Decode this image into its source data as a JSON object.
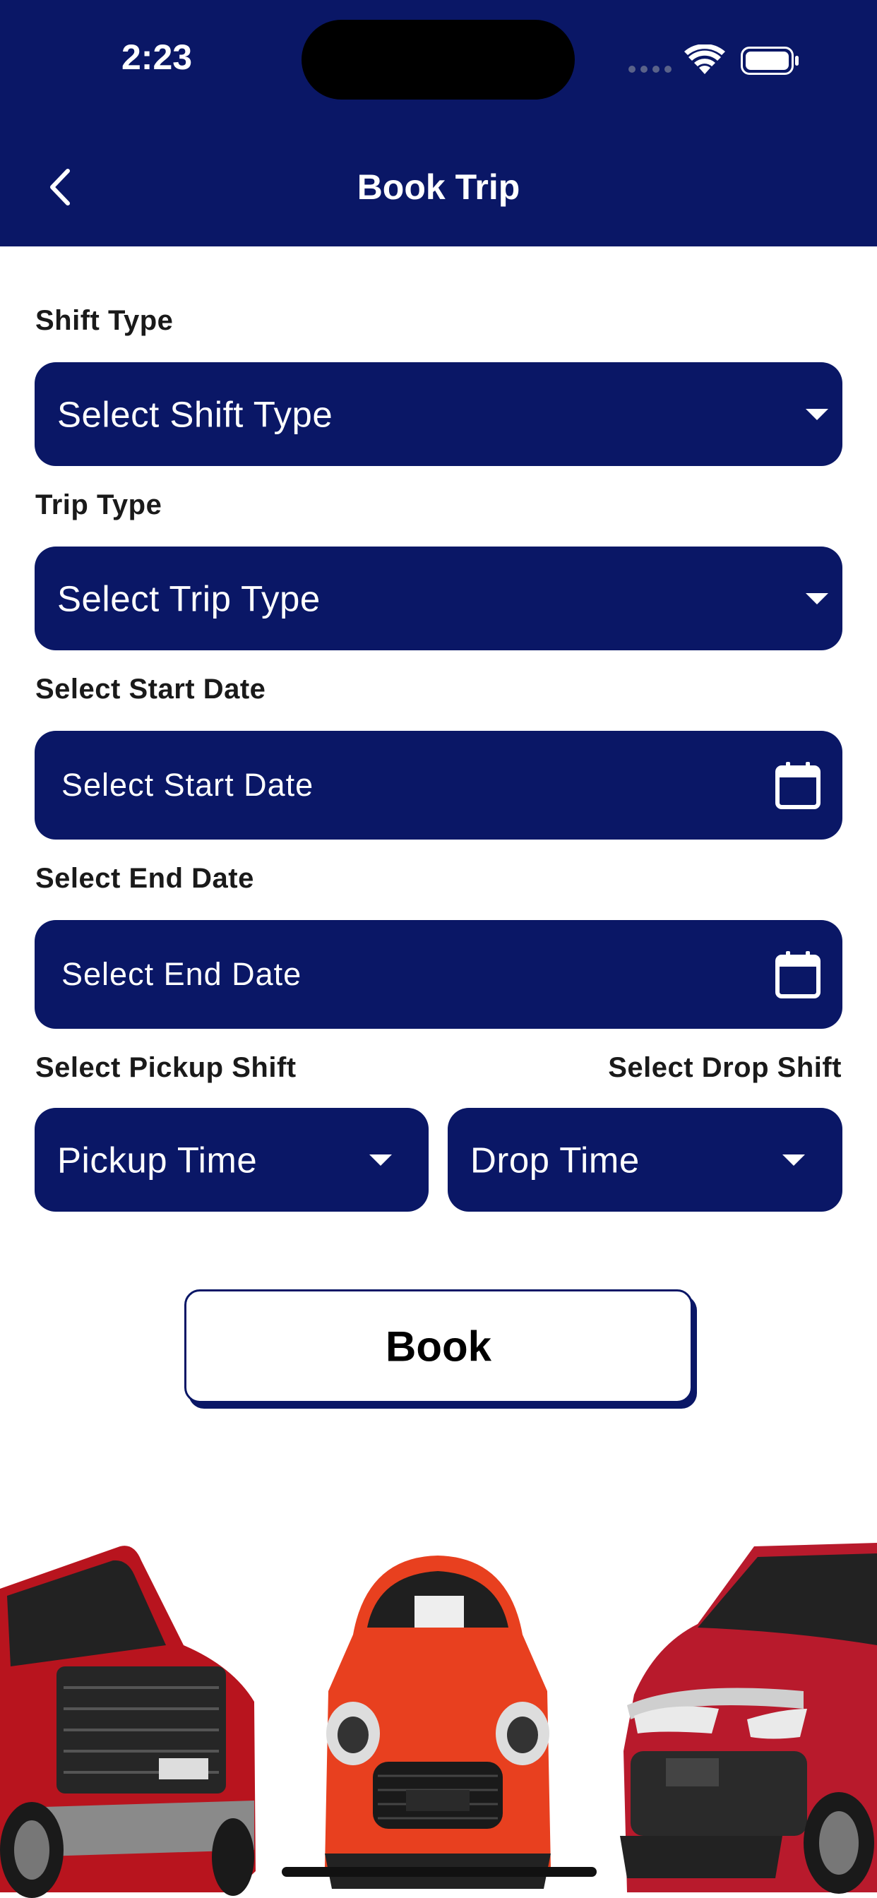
{
  "status_bar": {
    "time": "2:23"
  },
  "header": {
    "title": "Book Trip"
  },
  "form": {
    "shift_type": {
      "label": "Shift Type",
      "value": "Select Shift Type"
    },
    "trip_type": {
      "label": "Trip Type",
      "value": "Select Trip Type"
    },
    "start_date": {
      "label": "Select Start Date",
      "placeholder": "Select Start Date"
    },
    "end_date": {
      "label": "Select End Date",
      "placeholder": "Select End Date"
    },
    "pickup_shift": {
      "label": "Select Pickup Shift",
      "value": "Pickup Time"
    },
    "drop_shift": {
      "label": "Select Drop Shift",
      "value": "Drop Time"
    }
  },
  "book_button": {
    "label": "Book"
  },
  "colors": {
    "brand": "#0a1766",
    "car_red": "#c41a24",
    "car_orange": "#e8401f"
  },
  "icons": [
    "back-chevron-icon",
    "wifi-icon",
    "battery-icon",
    "chevron-down-icon",
    "calendar-icon"
  ]
}
